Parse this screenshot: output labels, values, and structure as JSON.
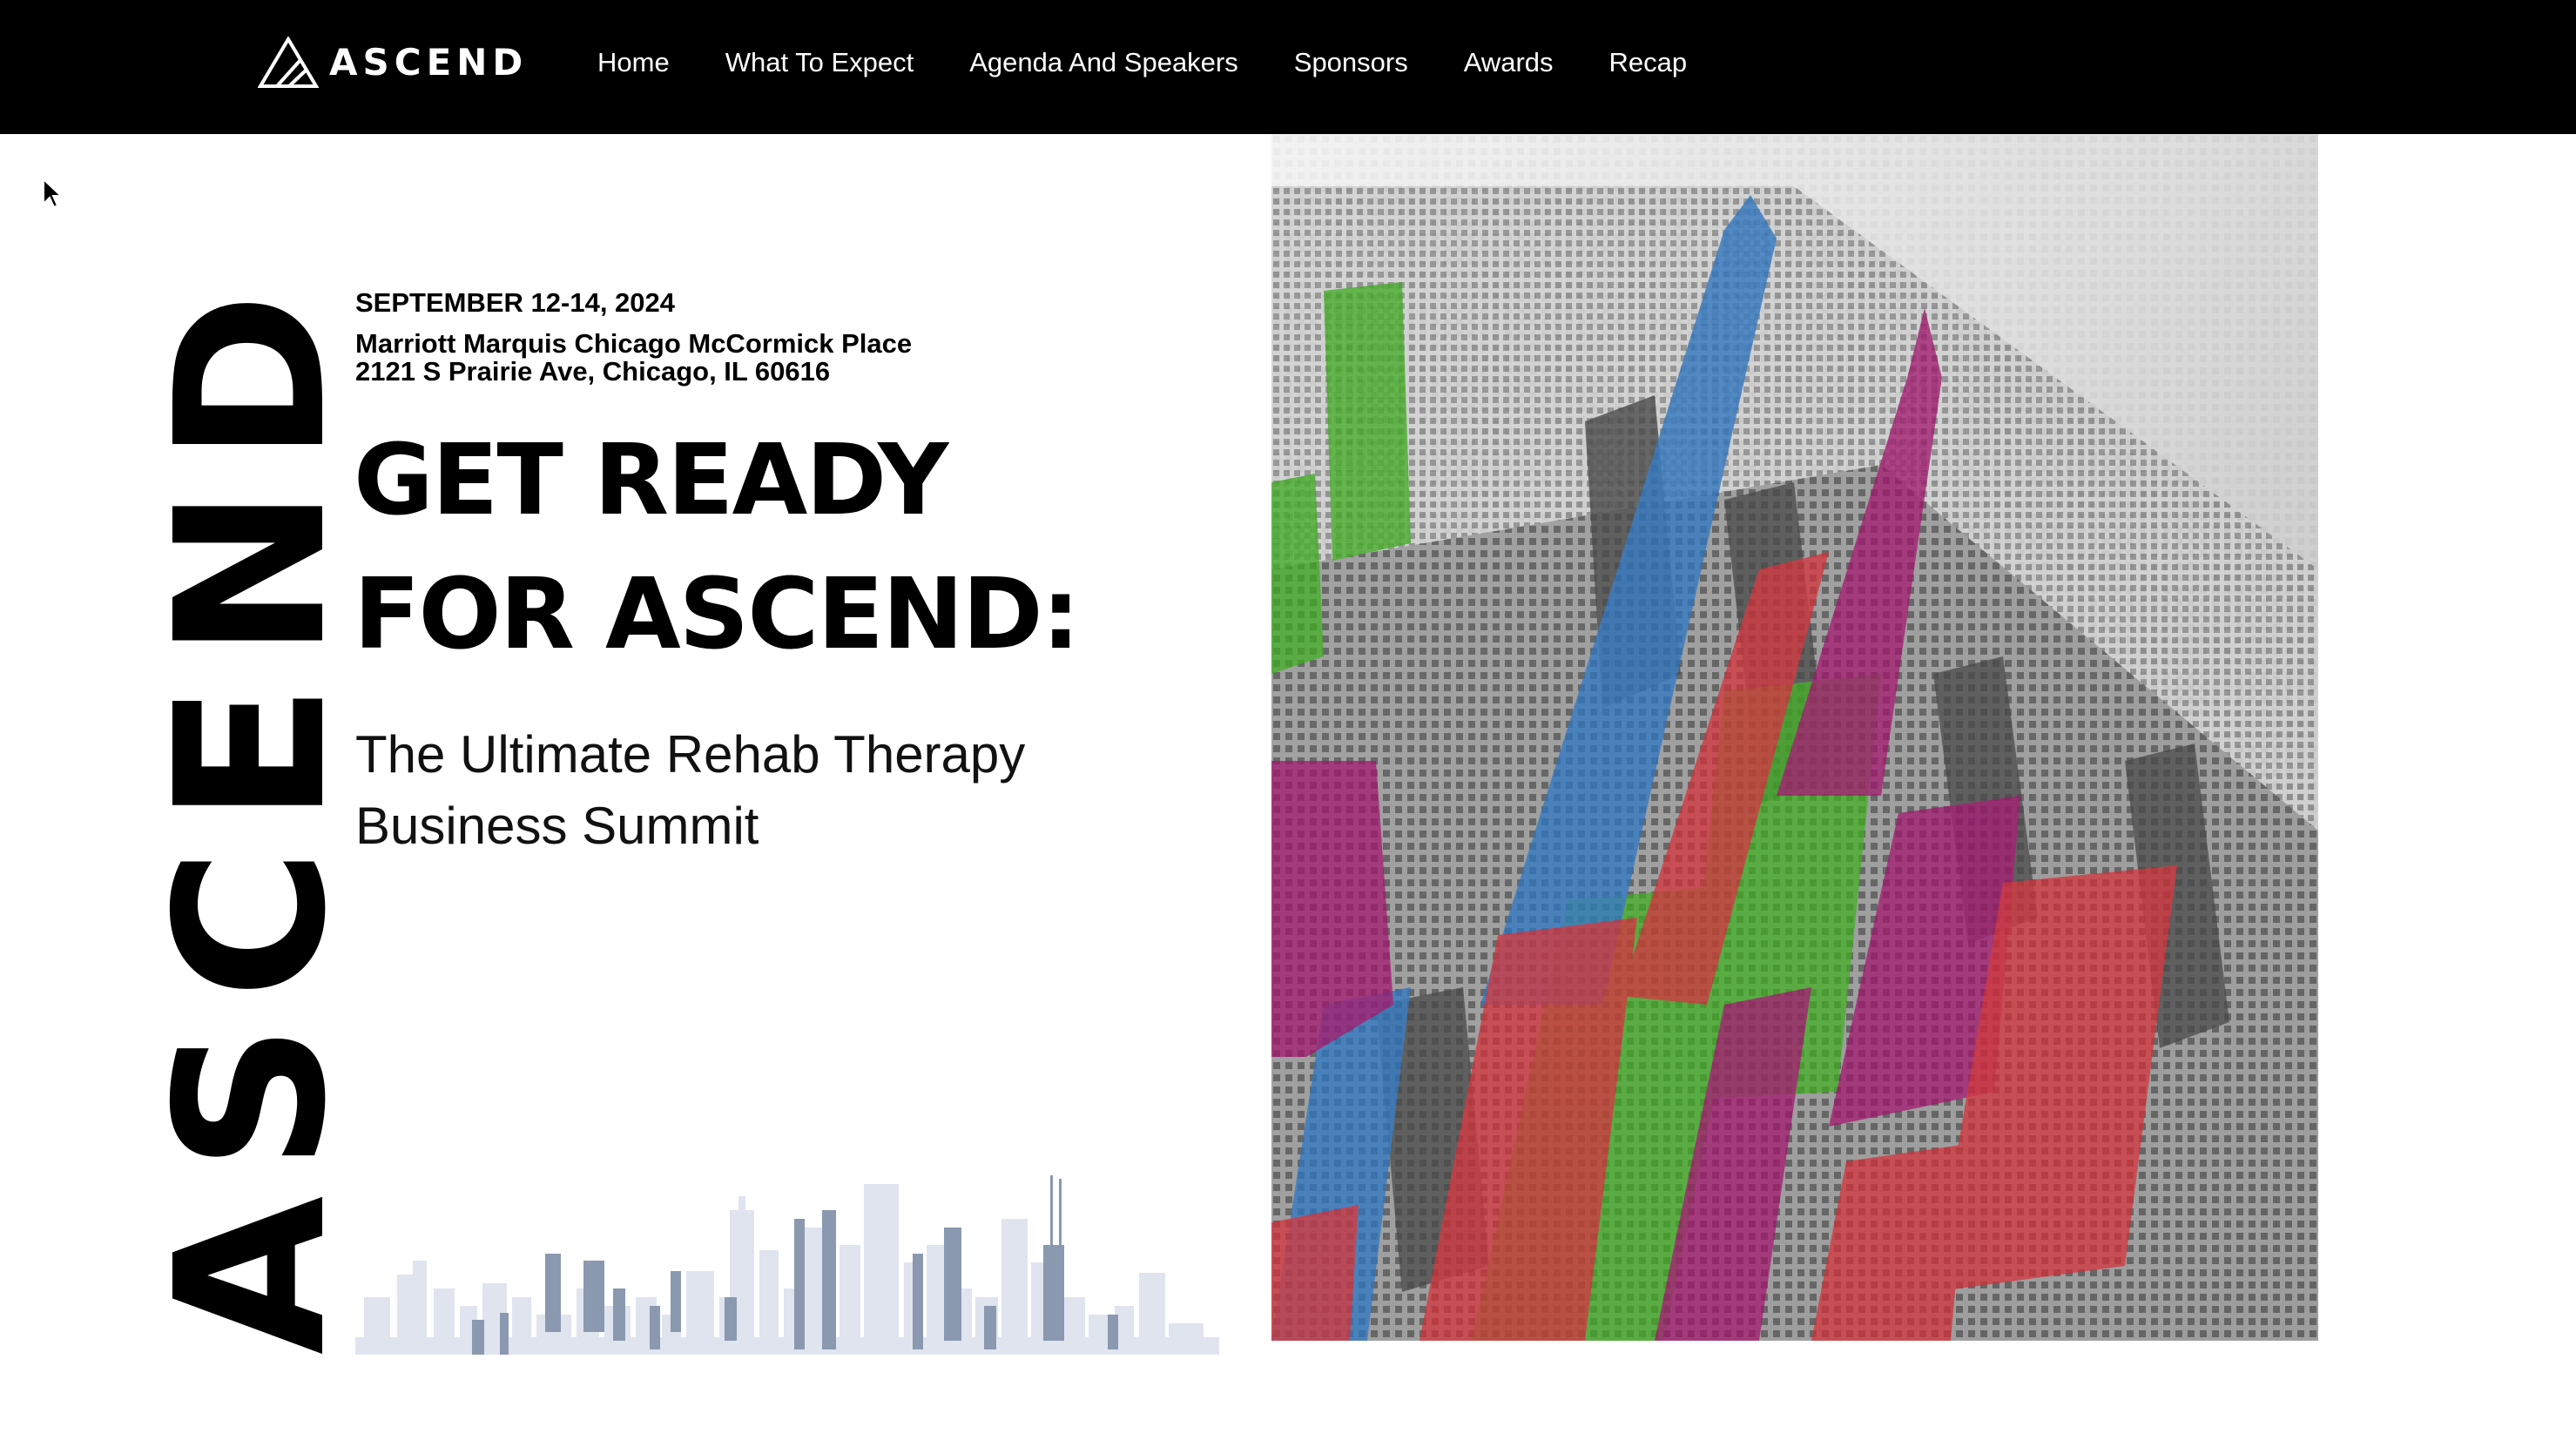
{
  "header": {
    "brand_name": "ASCEND",
    "logo_icon": "ascend-triangle-logo",
    "nav": [
      {
        "label": "Home"
      },
      {
        "label": "What To Expect"
      },
      {
        "label": "Agenda And Speakers"
      },
      {
        "label": "Sponsors"
      },
      {
        "label": "Awards"
      },
      {
        "label": "Recap"
      }
    ]
  },
  "hero": {
    "vertical_word": "ASCEND",
    "date": "SEPTEMBER 12-14, 2024",
    "venue_name": "Marriott Marquis Chicago McCormick Place",
    "venue_address": "2121 S Prairie Ave, Chicago, IL 60616",
    "headline_line1": "GET READY",
    "headline_line2": "FOR ASCEND:",
    "subtitle": "The Ultimate Rehab Therapy Business Summit",
    "skyline_graphic": "chicago-skyline-silhouette",
    "hero_image": "chicago-aerial-colorized-skyscrapers"
  },
  "colors": {
    "nav_background": "#000000",
    "page_background": "#ffffff",
    "skyline_light": "#dfe4ef",
    "skyline_dark": "#8a99b0",
    "accent_green": "#3fb020",
    "accent_blue": "#2f78c4",
    "accent_magenta": "#a3146e",
    "accent_red": "#d63038"
  }
}
